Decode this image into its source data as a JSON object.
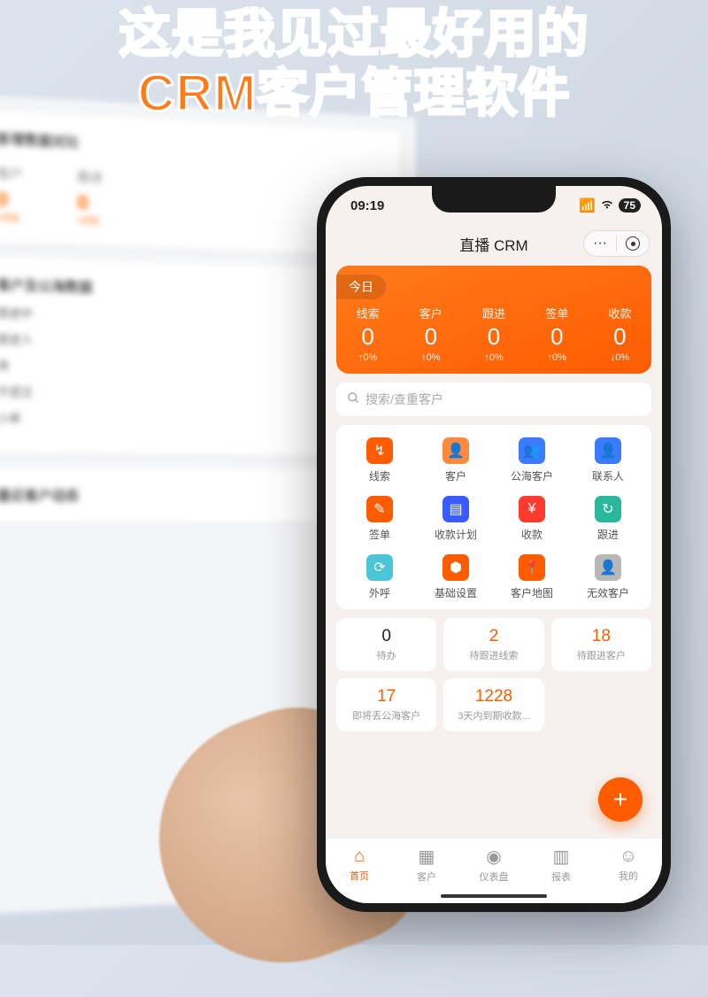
{
  "headline": {
    "line1": "这是我见过最好用的",
    "line2": "CRM客户管理软件"
  },
  "background": {
    "section1_title": "新增数据对比",
    "cols": [
      {
        "label": "客户",
        "value": "0",
        "pct": "+0%"
      },
      {
        "label": "跟进",
        "value": "0",
        "pct": "+0%"
      }
    ],
    "section2_title": "客户及公海数据",
    "items": [
      "跟进中",
      "跟进人",
      "待",
      "不成交",
      "小单"
    ],
    "section3_title": "最近客户动态"
  },
  "status": {
    "time": "09:19",
    "battery": "75"
  },
  "nav": {
    "title": "直播 CRM"
  },
  "hero": {
    "tab": "今日",
    "stats": [
      {
        "label": "线索",
        "value": "0",
        "pct": "↑0%"
      },
      {
        "label": "客户",
        "value": "0",
        "pct": "↑0%"
      },
      {
        "label": "跟进",
        "value": "0",
        "pct": "↑0%"
      },
      {
        "label": "签单",
        "value": "0",
        "pct": "↑0%"
      },
      {
        "label": "收款",
        "value": "0",
        "pct": "↓0%"
      }
    ]
  },
  "search": {
    "placeholder": "搜索/查重客户"
  },
  "grid": [
    {
      "label": "线索",
      "color": "#ff5c00",
      "icon": "↯"
    },
    {
      "label": "客户",
      "color": "#ff8a3d",
      "icon": "👤"
    },
    {
      "label": "公海客户",
      "color": "#3a7bff",
      "icon": "👥"
    },
    {
      "label": "联系人",
      "color": "#3a7bff",
      "icon": "👤"
    },
    {
      "label": "签单",
      "color": "#ff5c00",
      "icon": "✎"
    },
    {
      "label": "收款计划",
      "color": "#3a5bff",
      "icon": "▤"
    },
    {
      "label": "收款",
      "color": "#ff3b30",
      "icon": "¥"
    },
    {
      "label": "跟进",
      "color": "#2bb89a",
      "icon": "↻"
    },
    {
      "label": "外呼",
      "color": "#4dc5d9",
      "icon": "⟳"
    },
    {
      "label": "基础设置",
      "color": "#ff5c00",
      "icon": "⬢"
    },
    {
      "label": "客户地图",
      "color": "#ff5c00",
      "icon": "📍"
    },
    {
      "label": "无效客户",
      "color": "#b8b8b8",
      "icon": "👤"
    }
  ],
  "tiles": [
    {
      "value": "0",
      "label": "待办",
      "accent": false
    },
    {
      "value": "2",
      "label": "待跟进线索",
      "accent": true
    },
    {
      "value": "18",
      "label": "待跟进客户",
      "accent": true
    },
    {
      "value": "17",
      "label": "即将丢公海客户",
      "accent": true
    },
    {
      "value": "1228",
      "label": "3天内到期收款...",
      "accent": true
    }
  ],
  "tabs": [
    {
      "label": "首页",
      "icon": "⌂",
      "active": true
    },
    {
      "label": "客户",
      "icon": "▦",
      "active": false
    },
    {
      "label": "仪表盘",
      "icon": "◉",
      "active": false
    },
    {
      "label": "报表",
      "icon": "▥",
      "active": false
    },
    {
      "label": "我的",
      "icon": "☺",
      "active": false
    }
  ],
  "fab": {
    "glyph": "+"
  }
}
